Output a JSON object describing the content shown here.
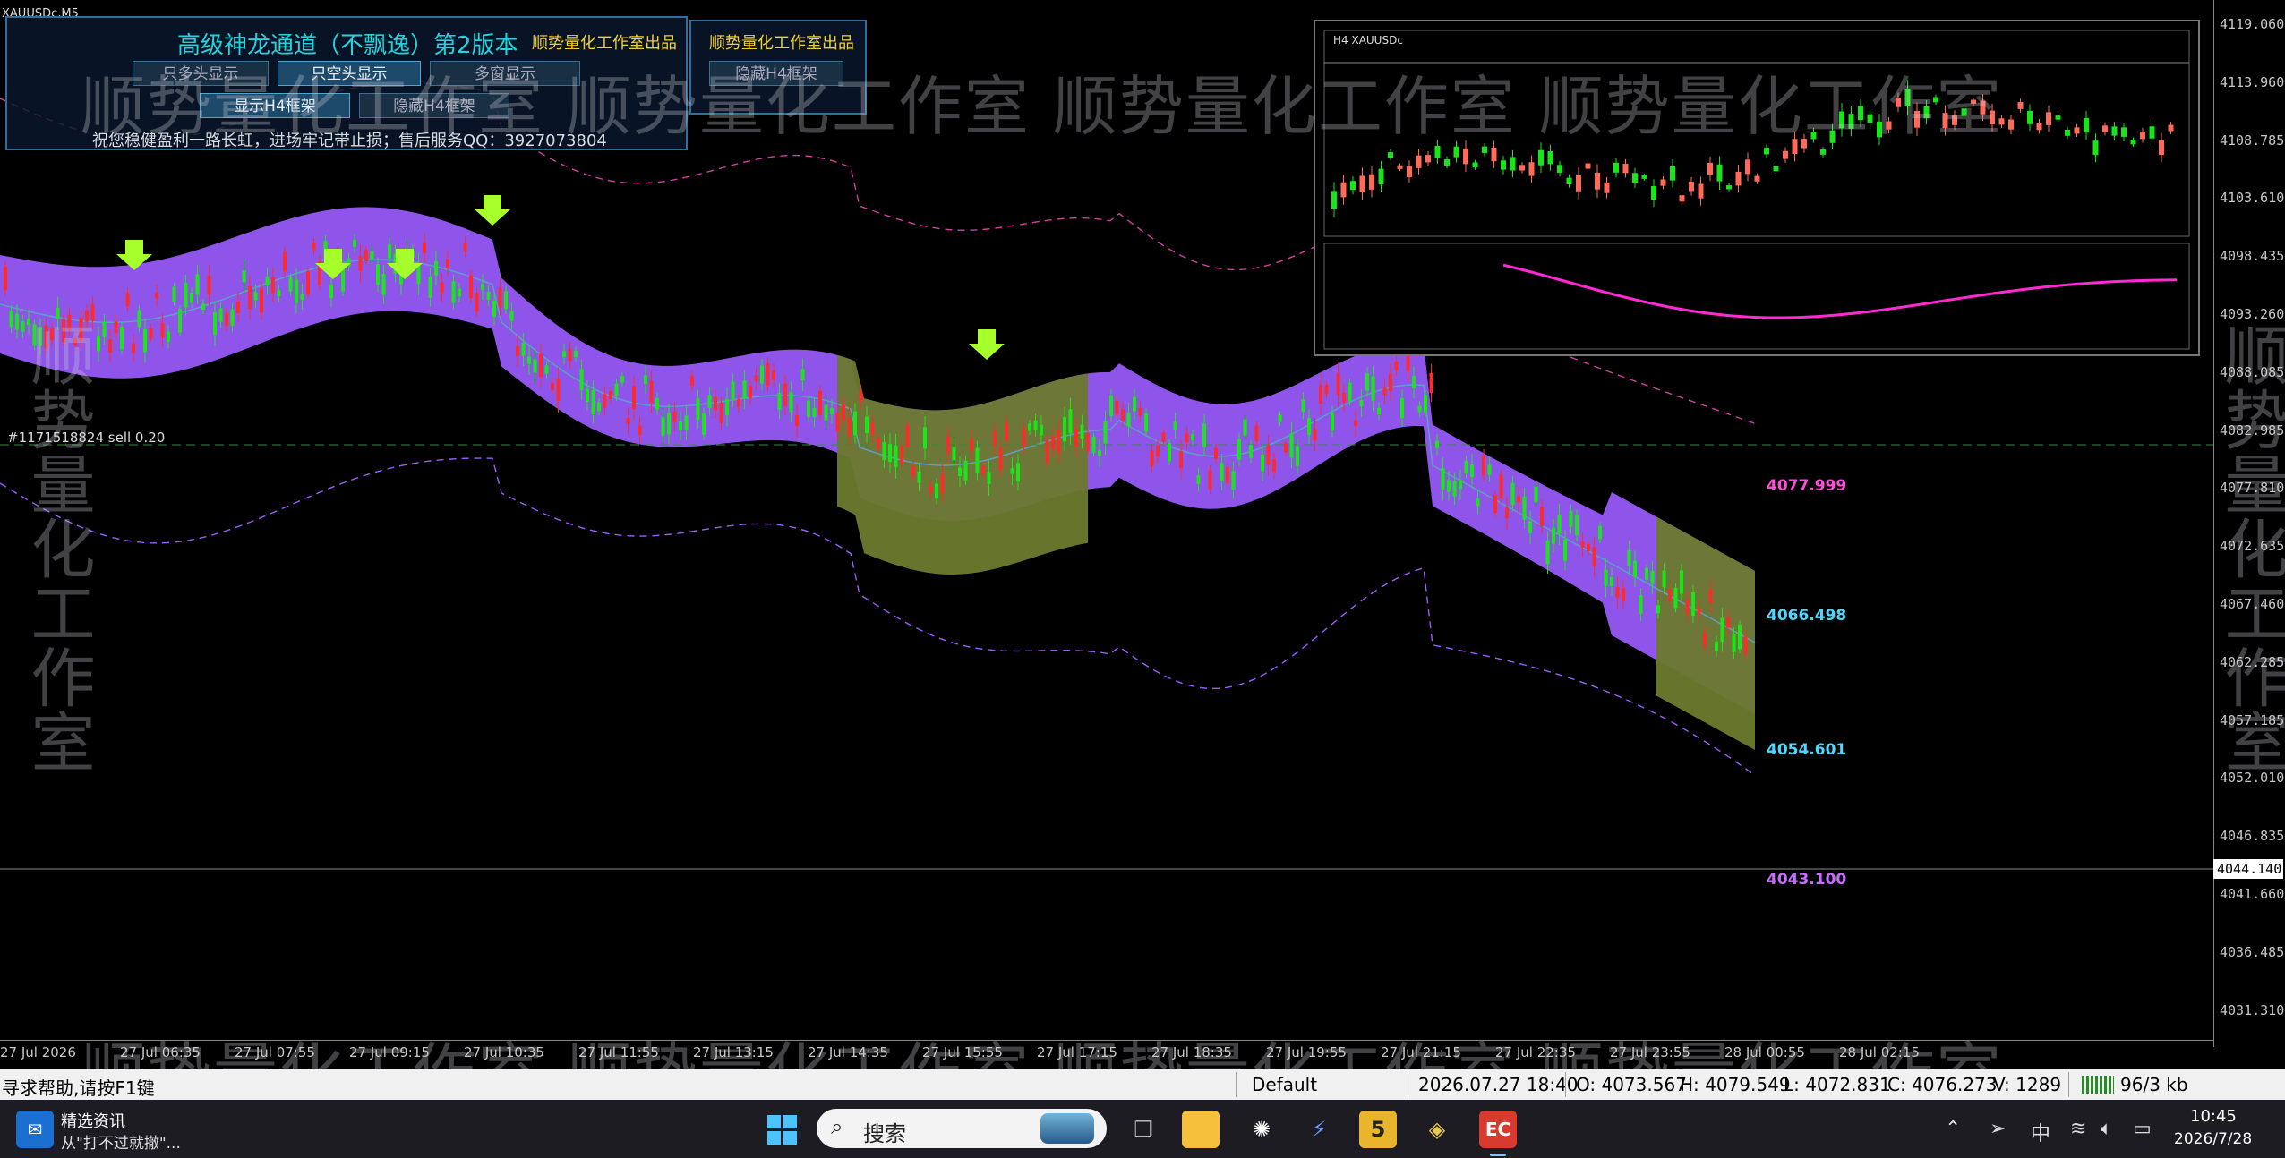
{
  "window": {
    "symbol_label": "XAUUSDc,M5"
  },
  "panel": {
    "title": "高级神龙通道（不飘逸）第2版本",
    "brand": "顺势量化工作室出品",
    "brand2": "顺势量化工作室出品",
    "btn_long_only": "只多头显示",
    "btn_short_only": "只空头显示",
    "btn_multi": "多窗显示",
    "btn_hide_h4_frame": "隐藏H4框架",
    "btn_show_h4_frame": "显示H4框架",
    "btn_hide_h4_frame2": "隐藏H4框架",
    "note": "祝您稳健盈利一路长虹，进场牢记带止损；售后服务QQ：3927073804"
  },
  "order_label": "#1171518824 sell 0.20",
  "watermark": "顺势量化工作室",
  "levels": [
    {
      "value": "4077.999",
      "color": "#ff4fd8"
    },
    {
      "value": "4066.498",
      "color": "#4fd8ff"
    },
    {
      "value": "4054.601",
      "color": "#4fd8ff"
    },
    {
      "value": "4043.100",
      "color": "#c86cff"
    }
  ],
  "inset": {
    "label": "H4  XAUUSDc"
  },
  "price_axis": {
    "ticks": [
      "4119.060",
      "4113.960",
      "4108.785",
      "4103.610",
      "4098.435",
      "4093.260",
      "4088.085",
      "4082.985",
      "4077.810",
      "4072.635",
      "4067.460",
      "4062.285",
      "4057.185",
      "4052.010",
      "4046.835",
      "4041.660",
      "4036.485",
      "4031.310"
    ],
    "current": "4044.140"
  },
  "time_axis": {
    "ticks": [
      "27 Jul 2026",
      "27 Jul 06:35",
      "27 Jul 07:55",
      "27 Jul 09:15",
      "27 Jul 10:35",
      "27 Jul 11:55",
      "27 Jul 13:15",
      "27 Jul 14:35",
      "27 Jul 15:55",
      "27 Jul 17:15",
      "27 Jul 18:35",
      "27 Jul 19:55",
      "27 Jul 21:15",
      "27 Jul 22:35",
      "27 Jul 23:55",
      "28 Jul 00:55",
      "28 Jul 02:15"
    ]
  },
  "status": {
    "help": "寻求帮助,请按F1键",
    "profile": "Default",
    "datetime": "2026.07.27 18:40",
    "open": "O: 4073.567",
    "high": "H: 4079.549",
    "low": "L: 4072.831",
    "close": "C: 4076.273",
    "volume": "V: 1289",
    "traffic": "96/3 kb"
  },
  "taskbar": {
    "news_title": "精选资讯",
    "news_sub": "从\"打不过就撤\"...",
    "search": "搜索",
    "ime": "中",
    "time": "10:45",
    "date": "2026/7/28"
  }
}
